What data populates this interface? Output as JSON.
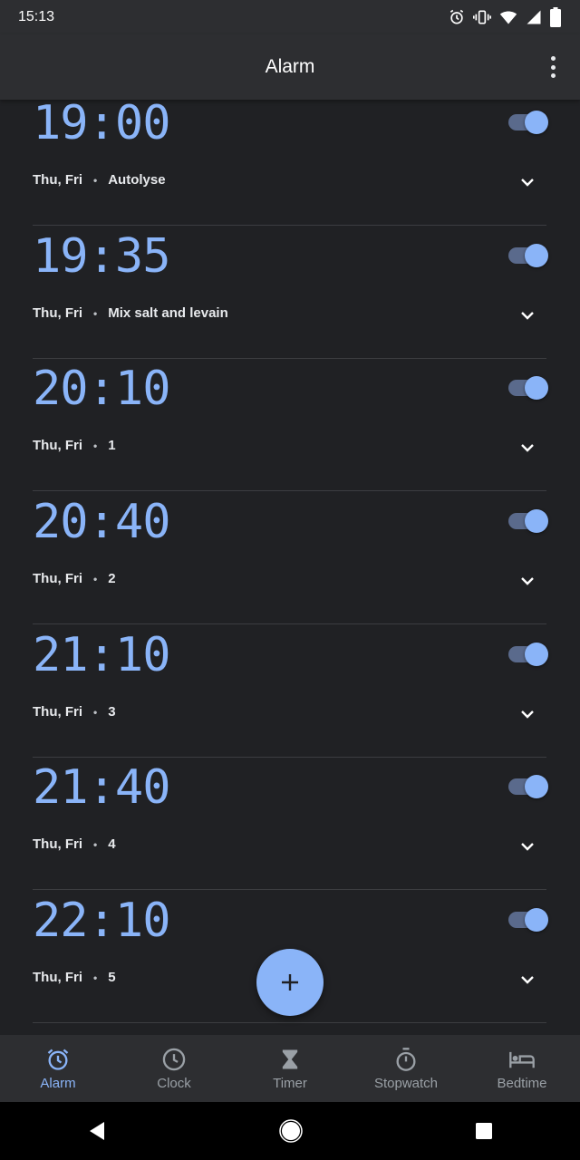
{
  "status_bar": {
    "time": "15:13",
    "icons": [
      "alarm-icon",
      "vibrate-icon",
      "wifi-icon",
      "signal-icon",
      "battery-icon"
    ]
  },
  "app_bar": {
    "title": "Alarm"
  },
  "alarms": [
    {
      "time": "19:00",
      "days": "Thu, Fri",
      "label": "Autolyse",
      "enabled": true
    },
    {
      "time": "19:35",
      "days": "Thu, Fri",
      "label": "Mix salt and levain",
      "enabled": true
    },
    {
      "time": "20:10",
      "days": "Thu, Fri",
      "label": "1",
      "enabled": true
    },
    {
      "time": "20:40",
      "days": "Thu, Fri",
      "label": "2",
      "enabled": true
    },
    {
      "time": "21:10",
      "days": "Thu, Fri",
      "label": "3",
      "enabled": true
    },
    {
      "time": "21:40",
      "days": "Thu, Fri",
      "label": "4",
      "enabled": true
    },
    {
      "time": "22:10",
      "days": "Thu, Fri",
      "label": "5",
      "enabled": true
    }
  ],
  "separator": "•",
  "bottom_nav": {
    "items": [
      {
        "label": "Alarm",
        "icon": "alarm-icon",
        "active": true
      },
      {
        "label": "Clock",
        "icon": "clock-icon",
        "active": false
      },
      {
        "label": "Timer",
        "icon": "hourglass-icon",
        "active": false
      },
      {
        "label": "Stopwatch",
        "icon": "stopwatch-icon",
        "active": false
      },
      {
        "label": "Bedtime",
        "icon": "bed-icon",
        "active": false
      }
    ]
  },
  "colors": {
    "accent": "#8ab4f8",
    "background": "#202124",
    "surface": "#2d2e31"
  }
}
